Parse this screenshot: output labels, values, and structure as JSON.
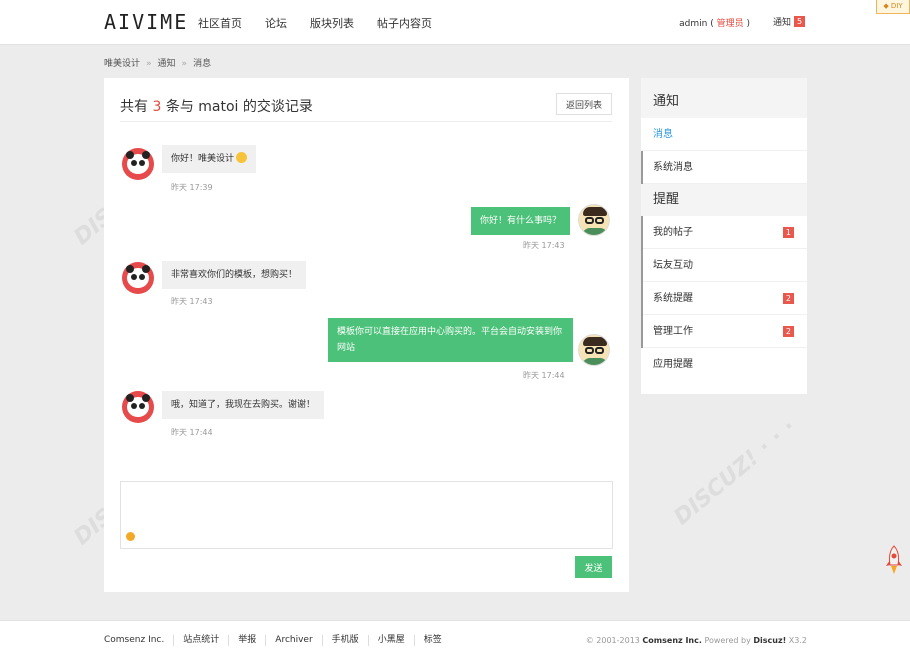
{
  "header": {
    "logo": "AIVIME",
    "nav": [
      "社区首页",
      "论坛",
      "版块列表",
      "帖子内容页"
    ],
    "user_name": "admin",
    "user_role_open": " ( ",
    "user_role": "管理员",
    "user_role_close": " )",
    "notify_label": "通知",
    "notify_count": "5",
    "diy_label": "◆ DIY"
  },
  "breadcrumb": {
    "items": [
      "唯美设计",
      "通知",
      "消息"
    ],
    "sep": "»"
  },
  "conversation": {
    "title_prefix": "共有 ",
    "count": "3",
    "title_suffix": " 条与 matoi 的交谈记录",
    "back_label": "返回列表",
    "messages": [
      {
        "side": "left",
        "text": "你好！唯美设计",
        "time": "昨天 17:39"
      },
      {
        "side": "right",
        "text": "你好！有什么事吗？",
        "time": "昨天 17:43"
      },
      {
        "side": "left",
        "text": "非常喜欢你们的模板，想购买！",
        "time": "昨天 17:43"
      },
      {
        "side": "right",
        "text": "模板你可以直接在应用中心购买的。平台会自动安装到你网站",
        "time": "昨天 17:44"
      },
      {
        "side": "left",
        "text": "哦，知道了，我现在去购买。谢谢！",
        "time": "昨天 17:44"
      }
    ],
    "send_label": "发送"
  },
  "sidebar": {
    "notice_head": "通知",
    "notice_items": [
      {
        "label": "消息",
        "active": true
      },
      {
        "label": "系统消息",
        "active": false
      }
    ],
    "remind_head": "提醒",
    "remind_items": [
      {
        "label": "我的帖子",
        "badge": "1"
      },
      {
        "label": "坛友互动",
        "badge": ""
      },
      {
        "label": "系统提醒",
        "badge": "2"
      },
      {
        "label": "管理工作",
        "badge": "2"
      },
      {
        "label": "应用提醒",
        "badge": ""
      }
    ]
  },
  "footer": {
    "links": [
      "Comsenz Inc.",
      "站点统计",
      "举报",
      "Archiver",
      "手机版",
      "小黑屋",
      "标签"
    ],
    "copy_prefix": "© 2001-2013 ",
    "copy_company": "Comsenz Inc.",
    "copy_powered": " Powered by ",
    "copy_product": "Discuz!",
    "copy_version": " X3.2"
  },
  "colors": {
    "accent_green": "#4cc179",
    "badge_red": "#e8584d",
    "link_blue": "#2b96e0"
  }
}
